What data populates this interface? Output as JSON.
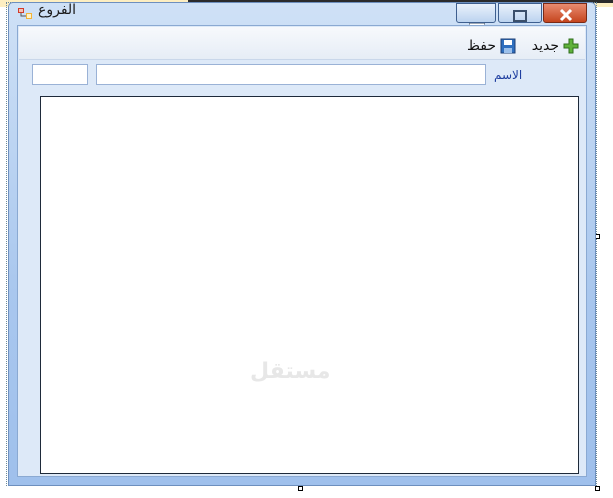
{
  "window": {
    "title": "الفروع",
    "icons": {
      "app": "form-app-icon",
      "minimize": "minimize-icon",
      "maximize": "maximize-icon",
      "close": "close-icon"
    }
  },
  "toolbar": {
    "new_label": "جديد",
    "new_icon": "green-plus-icon",
    "save_label": "حفظ",
    "save_icon": "floppy-disk-icon"
  },
  "form": {
    "name_label": "الاسم",
    "name_value": "",
    "code_value": ""
  },
  "watermark": {
    "text": "مستقل"
  },
  "colors": {
    "accent": "#1f3fa0",
    "close": "#c5451f",
    "plus": "#4a9a2a"
  }
}
